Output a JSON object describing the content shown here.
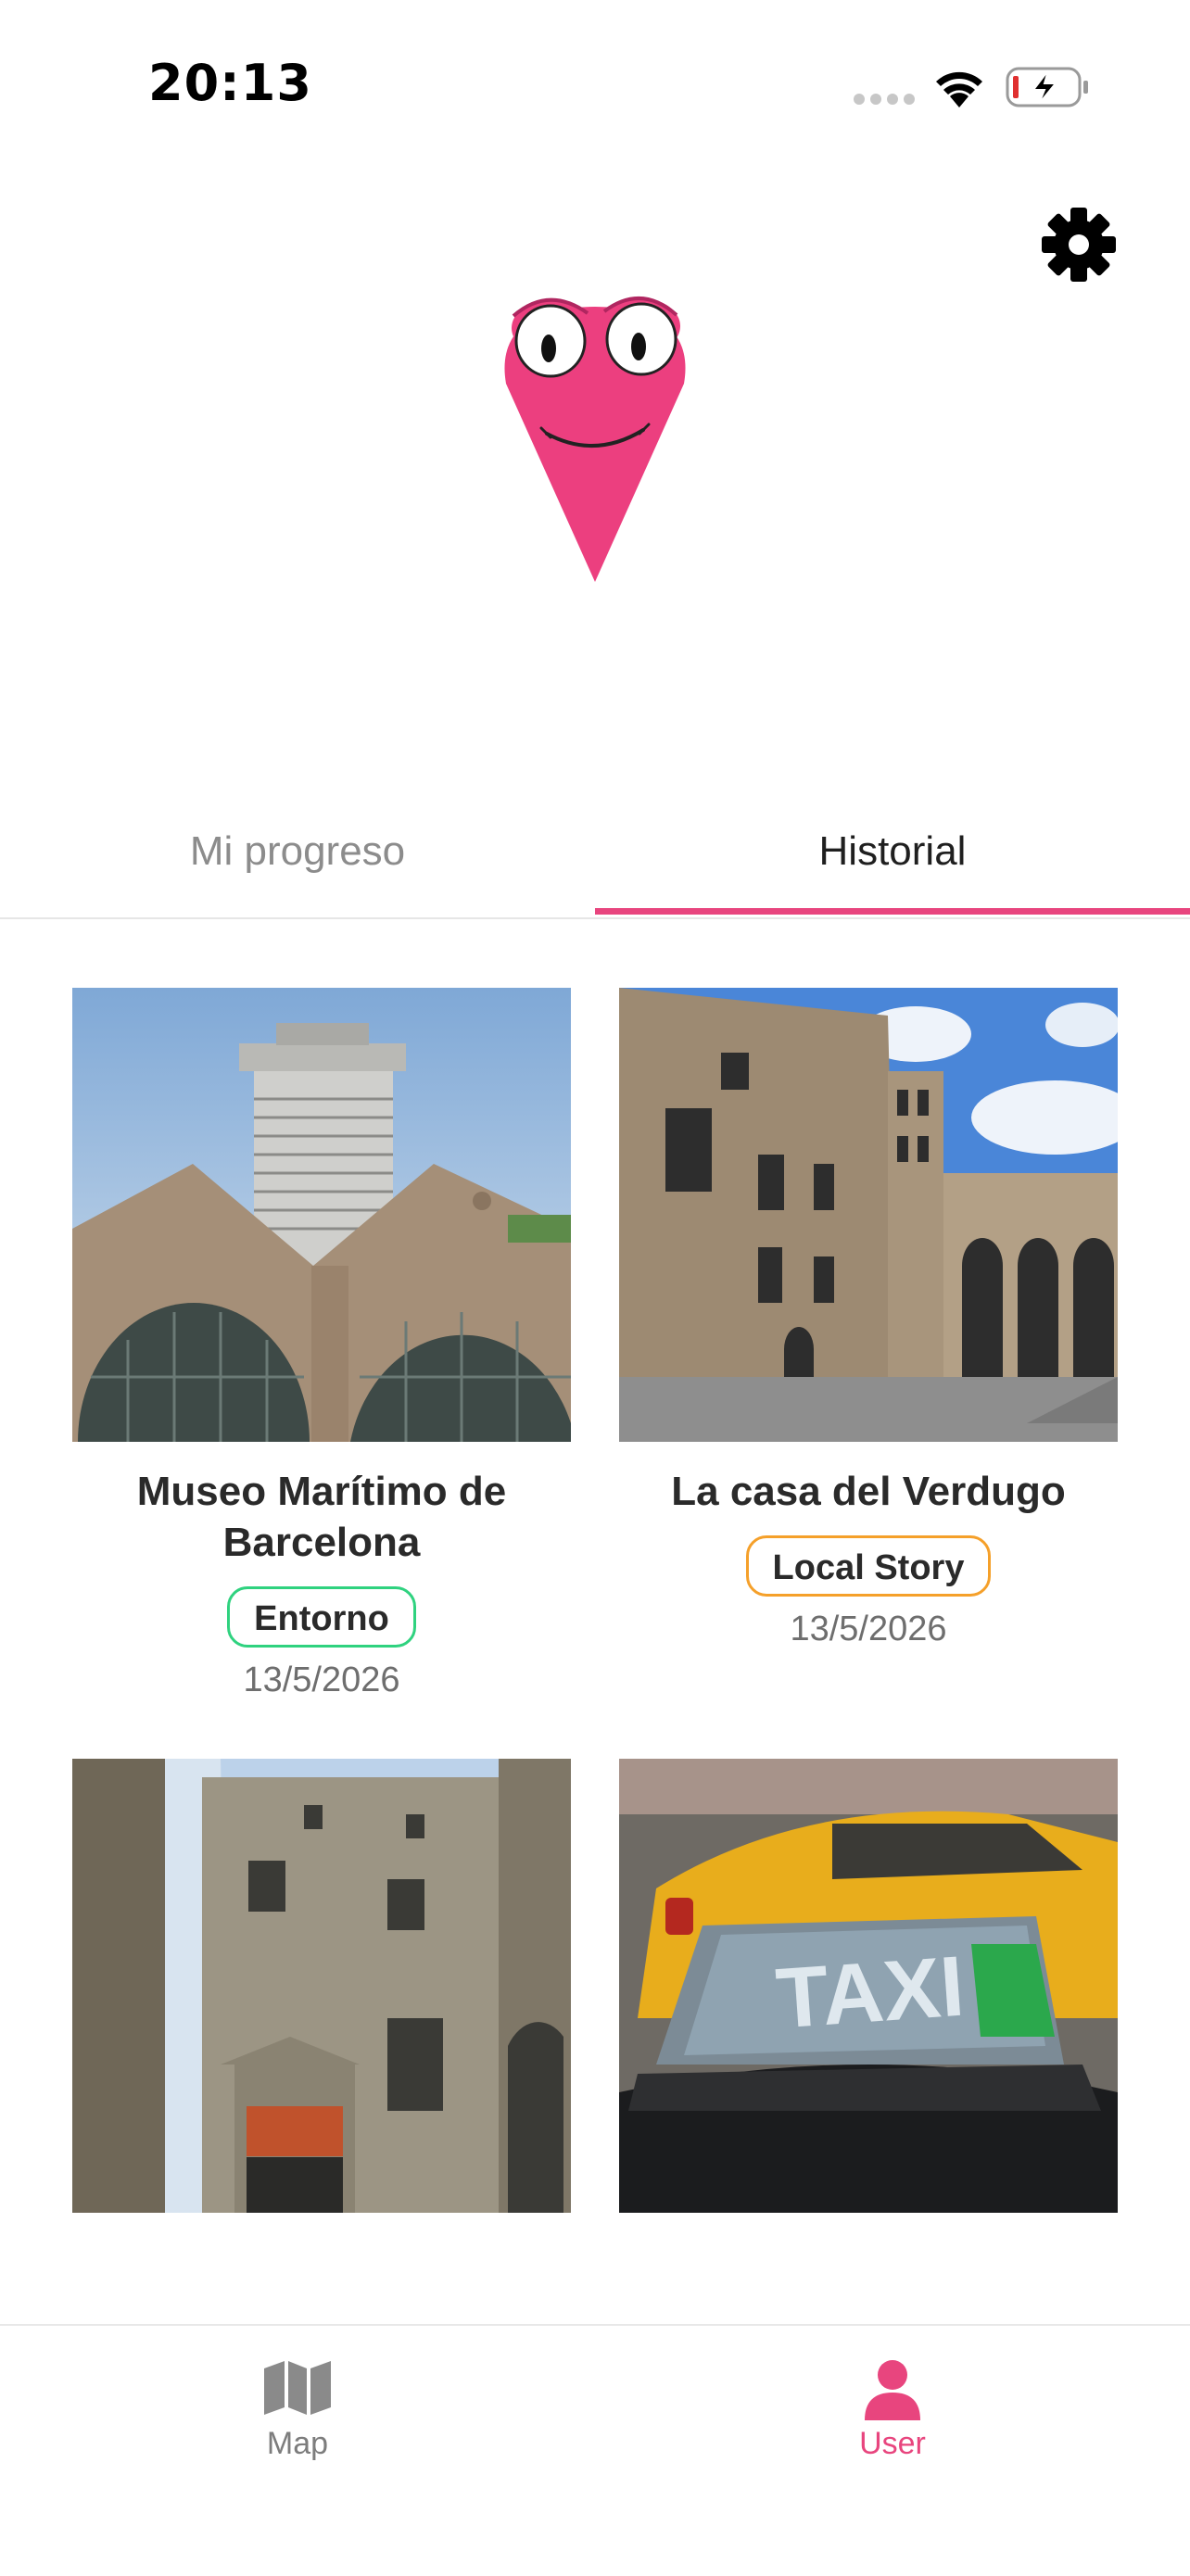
{
  "status_bar": {
    "time": "20:13"
  },
  "colors": {
    "accent": "#e8457e",
    "badge_green": "#2fd27f",
    "badge_orange": "#f5a02a"
  },
  "header": {
    "settings_icon": "gear-icon",
    "logo": "pink-map-pin-mascot"
  },
  "tabs": [
    {
      "label": "Mi progreso",
      "selected": false
    },
    {
      "label": "Historial",
      "selected": true
    }
  ],
  "history": [
    {
      "title": "Museo Marítimo de Barcelona",
      "badge": "Entorno",
      "badge_color": "green",
      "date": "13/5/2026",
      "image": "maritime-museum-arches-and-tower"
    },
    {
      "title": "La casa del Verdugo",
      "badge": "Local Story",
      "badge_color": "orange",
      "date": "13/5/2026",
      "image": "gothic-stone-courtyard"
    },
    {
      "title": "",
      "badge": "",
      "date": "",
      "image": "frederic-mares-museum-facade"
    },
    {
      "title": "",
      "badge": "",
      "date": "",
      "image": "barcelona-taxi-sign"
    }
  ],
  "bottom_nav": [
    {
      "label": "Map",
      "icon": "map-icon",
      "active": false
    },
    {
      "label": "User",
      "icon": "user-icon",
      "active": true
    }
  ]
}
